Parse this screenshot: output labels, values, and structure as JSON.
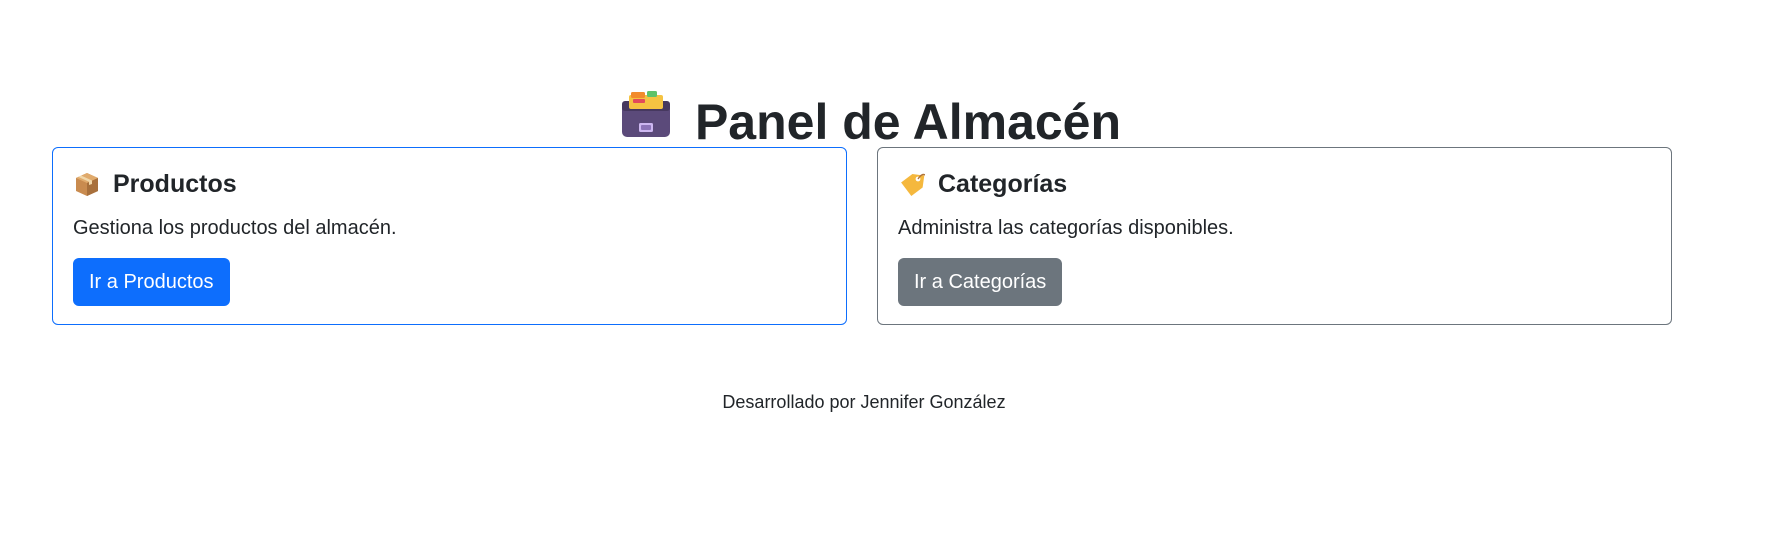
{
  "header": {
    "title": "Panel de Almacén",
    "icon": "card-file-box-icon"
  },
  "cards": [
    {
      "icon": "package-icon",
      "title": "Productos",
      "description": "Gestiona los productos del almacén.",
      "button_label": "Ir a Productos",
      "accent": "#0d6efd"
    },
    {
      "icon": "label-tag-icon",
      "title": "Categorías",
      "description": "Administra las categorías disponibles.",
      "button_label": "Ir a Categorías",
      "accent": "#6c757d"
    }
  ],
  "footer": {
    "text": "Desarrollado por Jennifer González"
  }
}
